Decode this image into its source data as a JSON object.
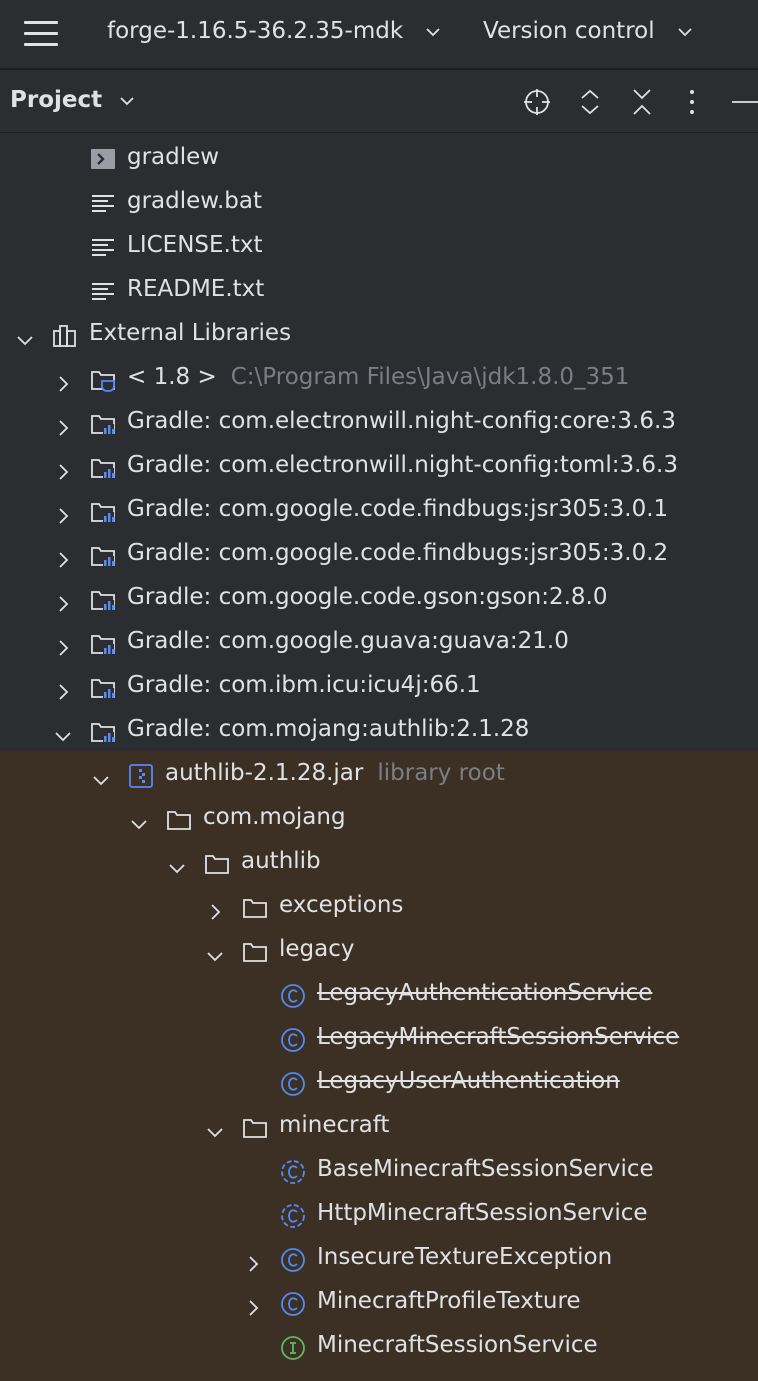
{
  "topbar": {
    "project_name": "forge-1.16.5-36.2.35-mdk",
    "vcs_label": "Version control"
  },
  "panel": {
    "title": "Project"
  },
  "tree": [
    {
      "label": "gradlew",
      "indent": 0,
      "icon": "terminal-icon",
      "arrow": "none"
    },
    {
      "label": "gradlew.bat",
      "indent": 0,
      "icon": "text-file-icon",
      "arrow": "none"
    },
    {
      "label": "LICENSE.txt",
      "indent": 0,
      "icon": "text-file-icon",
      "arrow": "none"
    },
    {
      "label": "README.txt",
      "indent": 0,
      "icon": "text-file-icon",
      "arrow": "none"
    },
    {
      "label": "External Libraries",
      "indent": -1,
      "icon": "library-icon",
      "arrow": "down"
    },
    {
      "label": "< 1.8 >",
      "suffix": "C:\\Program Files\\Java\\jdk1.8.0_351",
      "indent": 0,
      "icon": "jdk-folder-icon",
      "arrow": "right"
    },
    {
      "label": "Gradle: com.electronwill.night-config:core:3.6.3",
      "indent": 0,
      "icon": "gradle-lib-icon",
      "arrow": "right"
    },
    {
      "label": "Gradle: com.electronwill.night-config:toml:3.6.3",
      "indent": 0,
      "icon": "gradle-lib-icon",
      "arrow": "right"
    },
    {
      "label": "Gradle: com.google.code.findbugs:jsr305:3.0.1",
      "indent": 0,
      "icon": "gradle-lib-icon",
      "arrow": "right"
    },
    {
      "label": "Gradle: com.google.code.findbugs:jsr305:3.0.2",
      "indent": 0,
      "icon": "gradle-lib-icon",
      "arrow": "right"
    },
    {
      "label": "Gradle: com.google.code.gson:gson:2.8.0",
      "indent": 0,
      "icon": "gradle-lib-icon",
      "arrow": "right"
    },
    {
      "label": "Gradle: com.google.guava:guava:21.0",
      "indent": 0,
      "icon": "gradle-lib-icon",
      "arrow": "right"
    },
    {
      "label": "Gradle: com.ibm.icu:icu4j:66.1",
      "indent": 0,
      "icon": "gradle-lib-icon",
      "arrow": "right"
    },
    {
      "label": "Gradle: com.mojang:authlib:2.1.28",
      "indent": 0,
      "icon": "gradle-lib-icon",
      "arrow": "down"
    },
    {
      "label": "authlib-2.1.28.jar",
      "suffix": "library root",
      "indent": 1,
      "icon": "jar-icon",
      "arrow": "down"
    },
    {
      "label": "com.mojang",
      "indent": 2,
      "icon": "folder-icon",
      "arrow": "down"
    },
    {
      "label": "authlib",
      "indent": 3,
      "icon": "folder-icon",
      "arrow": "down"
    },
    {
      "label": "exceptions",
      "indent": 4,
      "icon": "folder-icon",
      "arrow": "right"
    },
    {
      "label": "legacy",
      "indent": 4,
      "icon": "folder-icon",
      "arrow": "down"
    },
    {
      "label": "LegacyAuthenticationService",
      "indent": 5,
      "icon": "class-icon",
      "arrow": "none",
      "deprecated": true
    },
    {
      "label": "LegacyMinecraftSessionService",
      "indent": 5,
      "icon": "class-icon",
      "arrow": "none",
      "deprecated": true
    },
    {
      "label": "LegacyUserAuthentication",
      "indent": 5,
      "icon": "class-icon",
      "arrow": "none",
      "deprecated": true
    },
    {
      "label": "minecraft",
      "indent": 4,
      "icon": "folder-icon",
      "arrow": "down"
    },
    {
      "label": "BaseMinecraftSessionService",
      "indent": 5,
      "icon": "abstract-class-icon",
      "arrow": "none"
    },
    {
      "label": "HttpMinecraftSessionService",
      "indent": 5,
      "icon": "abstract-class-icon",
      "arrow": "none"
    },
    {
      "label": "InsecureTextureException",
      "indent": 5,
      "icon": "class-icon",
      "arrow": "right"
    },
    {
      "label": "MinecraftProfileTexture",
      "indent": 5,
      "icon": "class-icon",
      "arrow": "right"
    },
    {
      "label": "MinecraftSessionService",
      "indent": 5,
      "icon": "interface-icon",
      "arrow": "none"
    }
  ],
  "colors": {
    "background": "#2b2d30",
    "highlight": "#3c3025",
    "text": "#dfe1e5",
    "muted": "#7b7e85",
    "class_icon": "#548af7",
    "interface_icon": "#5fb865"
  }
}
